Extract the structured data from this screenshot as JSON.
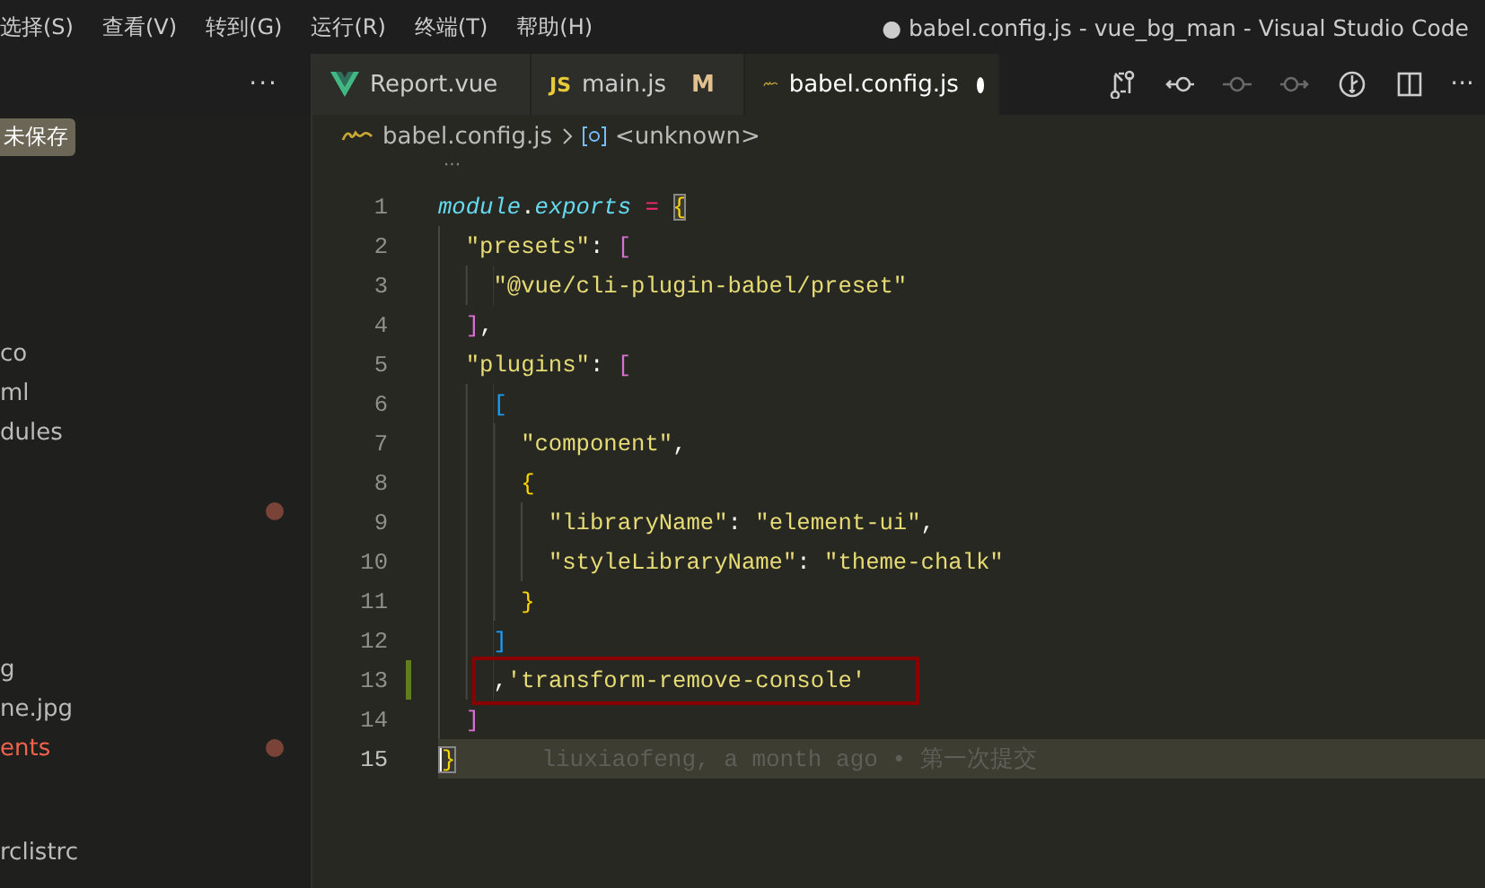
{
  "menu": [
    {
      "label": "选择(S)"
    },
    {
      "label": "查看(V)"
    },
    {
      "label": "转到(G)"
    },
    {
      "label": "运行(R)"
    },
    {
      "label": "终端(T)"
    },
    {
      "label": "帮助(H)"
    }
  ],
  "window": {
    "title": "● babel.config.js - vue_bg_man - Visual Studio Code"
  },
  "sidebar": {
    "more": "···",
    "badge": "未保存",
    "items": [
      {
        "label": "co",
        "modified": false
      },
      {
        "label": "ml",
        "modified": false
      },
      {
        "label": "dules",
        "modified": false
      },
      {
        "modified": true
      },
      {
        "label": "g",
        "modified": false
      },
      {
        "label": "ne.jpg",
        "modified": false
      },
      {
        "label": "ents",
        "modified": true
      },
      {
        "label": "rclistrc",
        "modified": false
      }
    ]
  },
  "tabs": [
    {
      "kind": "vue",
      "label": "Report.vue",
      "selected": false
    },
    {
      "kind": "js",
      "icon_text": "JS",
      "label": "main.js",
      "badge": "M",
      "selected": false
    },
    {
      "kind": "babel",
      "label": "babel.config.js",
      "dirty": true,
      "selected": true
    }
  ],
  "toolbar": {
    "more": "···",
    "actions": [
      {
        "kind": "compare",
        "disabled": false
      },
      {
        "kind": "prev",
        "disabled": false
      },
      {
        "kind": "commit",
        "disabled": true
      },
      {
        "kind": "next",
        "disabled": true
      },
      {
        "kind": "timeline",
        "disabled": false
      },
      {
        "kind": "split",
        "disabled": false
      }
    ]
  },
  "breadcrumb": {
    "file": "babel.config.js",
    "symbol": "<unknown>"
  },
  "editor": {
    "fold_hint": "···",
    "lines": [
      {
        "number": "1",
        "tokens": [
          {
            "kind": "ident",
            "text": "module"
          },
          {
            "kind": "punct",
            "text": "."
          },
          {
            "kind": "ident",
            "text": "exports"
          },
          {
            "kind": "op",
            "text": " = "
          },
          {
            "kind": "b1",
            "text": "{",
            "match": true
          }
        ]
      },
      {
        "number": "2",
        "tokens": [
          {
            "kind": "string",
            "text": "  \"presets\""
          },
          {
            "kind": "punct",
            "text": ": "
          },
          {
            "kind": "b2",
            "text": "["
          }
        ]
      },
      {
        "number": "3",
        "tokens": [
          {
            "kind": "string",
            "text": "    \"@vue/cli-plugin-babel/preset\""
          }
        ]
      },
      {
        "number": "4",
        "tokens": [
          {
            "kind": "b2",
            "text": "  ]"
          },
          {
            "kind": "punct",
            "text": ","
          }
        ]
      },
      {
        "number": "5",
        "tokens": [
          {
            "kind": "string",
            "text": "  \"plugins\""
          },
          {
            "kind": "punct",
            "text": ": "
          },
          {
            "kind": "b2",
            "text": "["
          }
        ]
      },
      {
        "number": "6",
        "tokens": [
          {
            "kind": "b3",
            "text": "    ["
          }
        ]
      },
      {
        "number": "7",
        "tokens": [
          {
            "kind": "string",
            "text": "      \"component\""
          },
          {
            "kind": "punct",
            "text": ","
          }
        ]
      },
      {
        "number": "8",
        "tokens": [
          {
            "kind": "b1",
            "text": "      {"
          }
        ]
      },
      {
        "number": "9",
        "tokens": [
          {
            "kind": "string",
            "text": "        \"libraryName\""
          },
          {
            "kind": "punct",
            "text": ": "
          },
          {
            "kind": "string",
            "text": "\"element-ui\""
          },
          {
            "kind": "punct",
            "text": ","
          }
        ]
      },
      {
        "number": "10",
        "tokens": [
          {
            "kind": "string",
            "text": "        \"styleLibraryName\""
          },
          {
            "kind": "punct",
            "text": ": "
          },
          {
            "kind": "string",
            "text": "\"theme-chalk\""
          }
        ]
      },
      {
        "number": "11",
        "tokens": [
          {
            "kind": "b1",
            "text": "      }"
          }
        ]
      },
      {
        "number": "12",
        "tokens": [
          {
            "kind": "b3",
            "text": "    ]"
          }
        ]
      },
      {
        "number": "13",
        "added": true,
        "boxed": true,
        "tokens": [
          {
            "kind": "punct",
            "text": "    ,"
          },
          {
            "kind": "string",
            "text": "'transform-remove-console'"
          }
        ]
      },
      {
        "number": "14",
        "tokens": [
          {
            "kind": "b2",
            "text": "  ]"
          }
        ]
      },
      {
        "number": "15",
        "current": true,
        "blame": "liuxiaofeng, a month ago • 第一次提交",
        "tokens": [
          {
            "kind": "b1",
            "text": "}",
            "match": true
          }
        ]
      }
    ]
  }
}
